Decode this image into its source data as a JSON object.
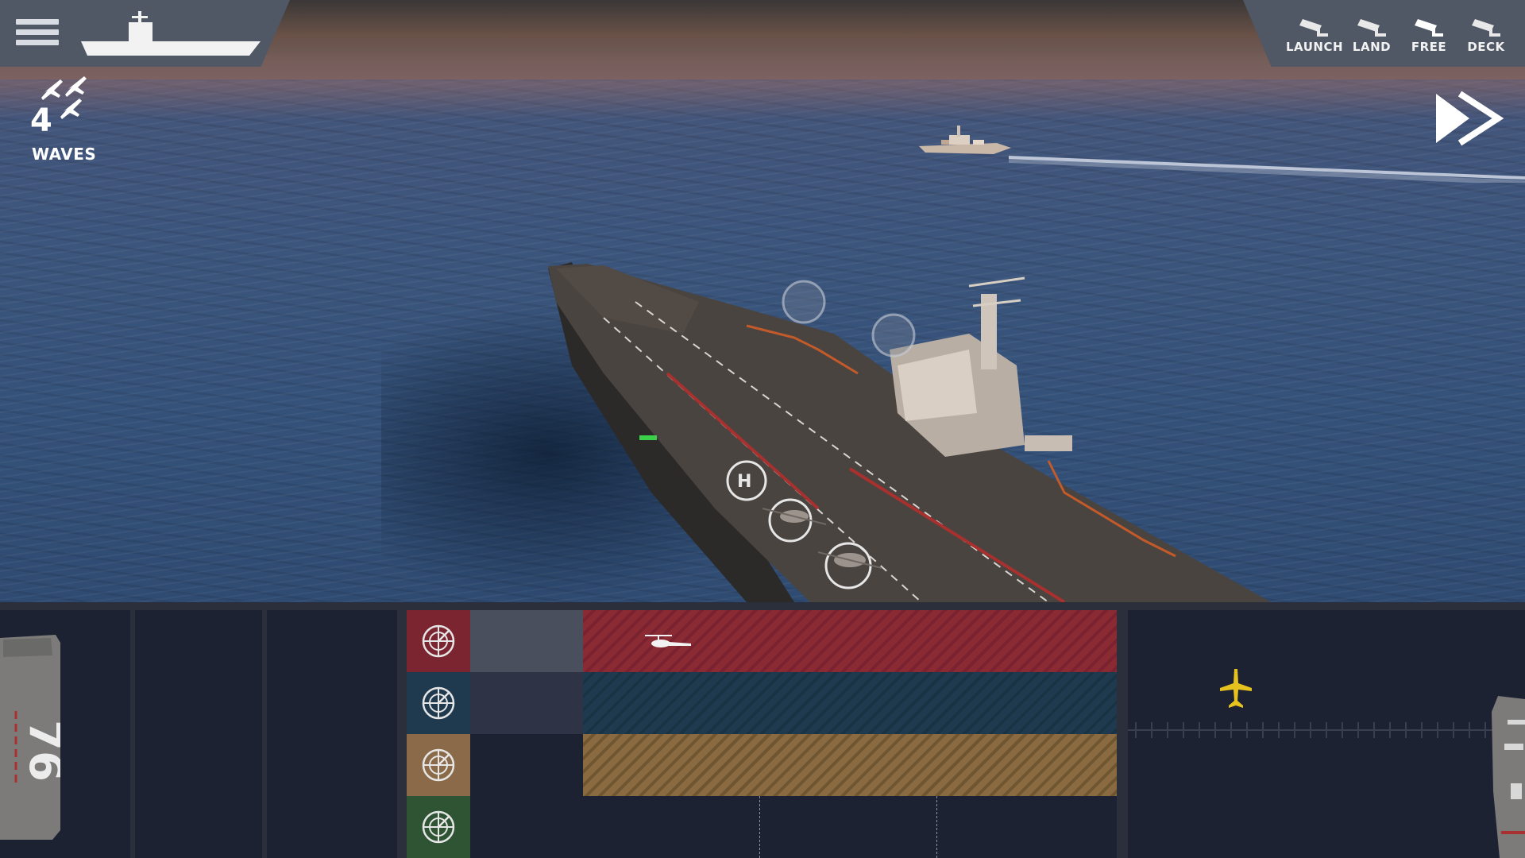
{
  "hud": {
    "waves_count": "4",
    "waves_label": "WAVES"
  },
  "camera_modes": [
    {
      "id": "launch",
      "label": "LAUNCH"
    },
    {
      "id": "land",
      "label": "LAND"
    },
    {
      "id": "free",
      "label": "FREE"
    },
    {
      "id": "deck",
      "label": "DECK"
    }
  ],
  "lanes": [
    {
      "color": "#8a2a33",
      "icon_bg": "#7a2530",
      "queue_bg": "#4a4f5e",
      "content": "helicopter"
    },
    {
      "color": "#1f3a4e",
      "icon_bg": "#1f3a4e",
      "queue_bg": "#2e3346",
      "content": ""
    },
    {
      "color": "#8a6a40",
      "icon_bg": "#8a6a48",
      "queue_bg": "#1d2232",
      "content": ""
    },
    {
      "color": "#1d2232",
      "icon_bg": "#2e5434",
      "queue_bg": "#1d2232",
      "content": ""
    }
  ],
  "elevator_marking": "76",
  "colors": {
    "hud_panel": "#505866",
    "accent_yellow": "#e6c21f"
  }
}
